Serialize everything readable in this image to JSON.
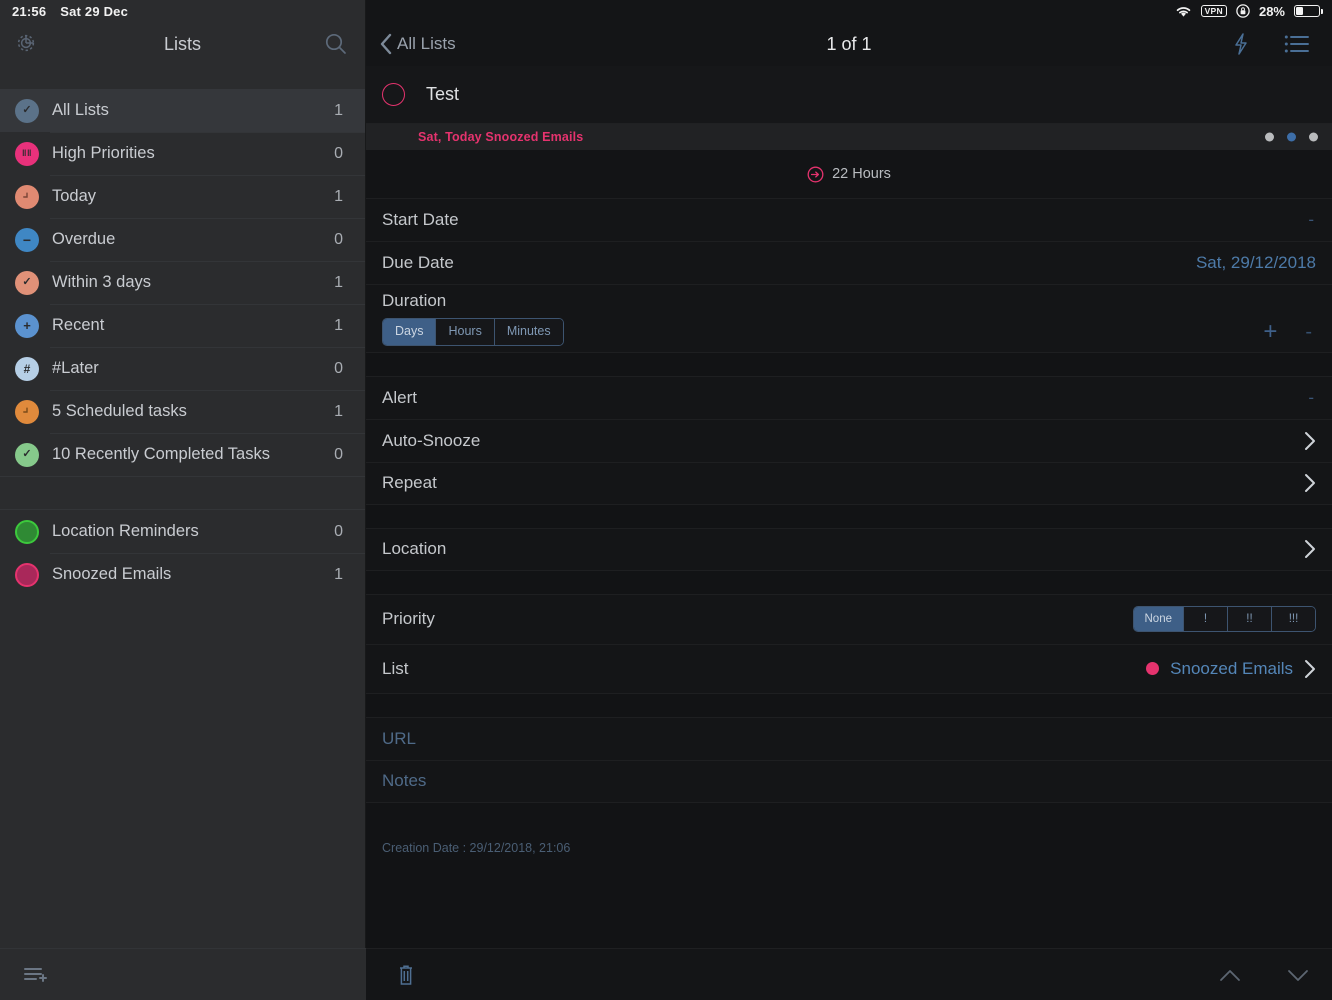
{
  "status_bar": {
    "time": "21:56",
    "date": "Sat 29 Dec",
    "battery_percent": "28%",
    "wifi_icon": "wifi-icon",
    "vpn_label": "VPN",
    "lock_icon": "rotation-lock-icon",
    "battery_icon": "battery-icon"
  },
  "sidebar": {
    "title": "Lists",
    "gear_icon": "gear-icon",
    "search_icon": "search-icon",
    "add_list_icon": "add-list-icon",
    "items": [
      {
        "label": "All Lists",
        "count": "1",
        "color": "#5b7289",
        "glyph": "✓",
        "selected": true
      },
      {
        "label": "High Priorities",
        "count": "0",
        "color": "#e8317b",
        "glyph": "!!!",
        "selected": false
      },
      {
        "label": "Today",
        "count": "1",
        "color": "#e08a72",
        "glyph": "◔",
        "selected": false
      },
      {
        "label": "Overdue",
        "count": "0",
        "color": "#3f87c4",
        "glyph": "–",
        "selected": false
      },
      {
        "label": "Within 3 days",
        "count": "1",
        "color": "#e09178",
        "glyph": "✓",
        "selected": false
      },
      {
        "label": "Recent",
        "count": "1",
        "color": "#5b92cf",
        "glyph": "+",
        "selected": false
      },
      {
        "label": "#Later",
        "count": "0",
        "color": "#b6cfe6",
        "glyph": "#",
        "selected": false
      },
      {
        "label": "5 Scheduled tasks",
        "count": "1",
        "color": "#e08a3c",
        "glyph": "◔",
        "selected": false
      },
      {
        "label": "10 Recently Completed Tasks",
        "count": "0",
        "color": "#86c98b",
        "glyph": "✓",
        "selected": false
      }
    ],
    "items2": [
      {
        "label": "Location Reminders",
        "count": "0",
        "color": "#3cc93c",
        "ring": true
      },
      {
        "label": "Snoozed Emails",
        "count": "1",
        "color": "#e5336e",
        "ring": true
      }
    ]
  },
  "main": {
    "back_label": "All Lists",
    "back_icon": "chevron-left-icon",
    "title": "1 of 1",
    "flash_icon": "lightning-bolt-icon",
    "list_icon": "list-view-icon",
    "task": {
      "title": "Test",
      "checkbox_icon": "task-circle-unchecked-icon",
      "meta": "Sat, Today  Snoozed Emails",
      "page_dots": [
        "inactive",
        "active",
        "inactive"
      ]
    },
    "duration_badge": {
      "icon": "snooze-arrow-icon",
      "text": "22 Hours"
    },
    "rows": {
      "start_date": {
        "label": "Start Date",
        "value": "-"
      },
      "due_date": {
        "label": "Due Date",
        "value": "Sat, 29/12/2018"
      },
      "duration": {
        "label": "Duration",
        "segments": [
          "Days",
          "Hours",
          "Minutes"
        ],
        "selected": "Days",
        "plus": "+",
        "minus": "-"
      },
      "alert": {
        "label": "Alert",
        "value": "-"
      },
      "auto_snooze": {
        "label": "Auto-Snooze",
        "chevron_icon": "chevron-right-icon"
      },
      "repeat": {
        "label": "Repeat",
        "chevron_icon": "chevron-right-icon"
      },
      "location": {
        "label": "Location",
        "chevron_icon": "chevron-right-icon"
      },
      "priority": {
        "label": "Priority",
        "segments": [
          "None",
          "!",
          "!!",
          "!!!"
        ],
        "selected": "None"
      },
      "list": {
        "label": "List",
        "value": "Snoozed Emails",
        "dot_color": "#e5336e",
        "chevron_icon": "chevron-right-icon"
      },
      "url": {
        "label": "URL"
      },
      "notes": {
        "label": "Notes"
      }
    },
    "creation_date": "Creation Date : 29/12/2018, 21:06",
    "footer": {
      "delete_icon": "trash-icon",
      "prev_icon": "chevron-up-icon",
      "next_icon": "chevron-down-icon"
    }
  }
}
